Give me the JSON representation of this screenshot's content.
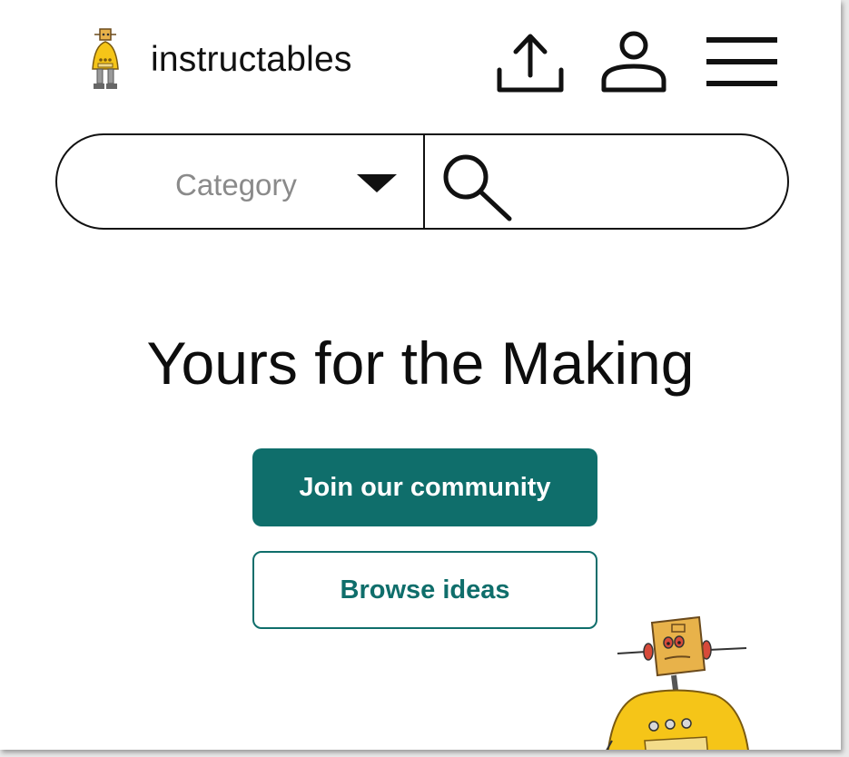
{
  "header": {
    "brand": "instructables",
    "logo": "instructables-robot-logo",
    "icons": [
      "upload-icon",
      "user-icon",
      "hamburger-menu-icon"
    ]
  },
  "search": {
    "category_label": "Category",
    "category_icon": "caret-down-icon",
    "search_icon": "search-icon",
    "input_value": "",
    "placeholder": ""
  },
  "hero": {
    "title": "Yours for the Making",
    "primary_button": "Join our community",
    "secondary_button": "Browse ideas",
    "illustration": "robot-mascot-illustration"
  },
  "colors": {
    "accent": "#0f6e6b",
    "mascot_yellow": "#f5c518",
    "text": "#111111",
    "muted": "#8a8a8a"
  }
}
